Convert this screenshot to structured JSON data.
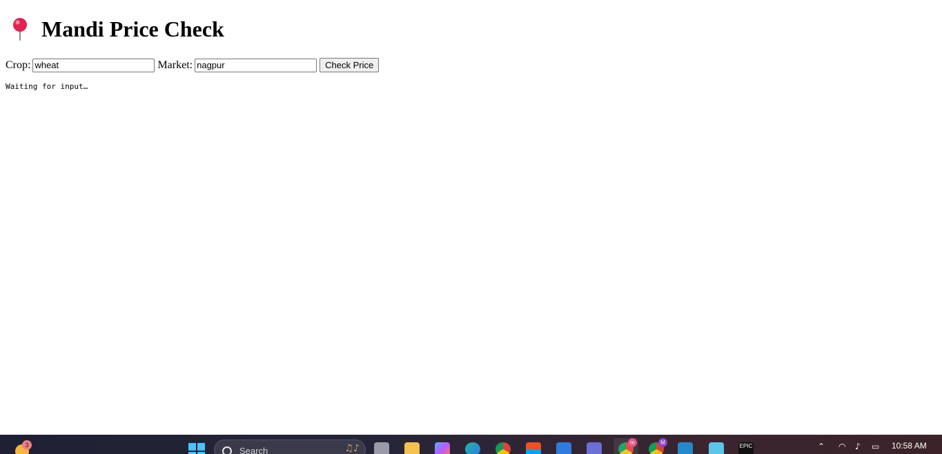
{
  "page": {
    "title_icon": "pushpin-icon",
    "title": "Mandi Price Check"
  },
  "form": {
    "crop_label": "Crop:",
    "crop_value": "wheat",
    "market_label": "Market:",
    "market_value": "nagpur",
    "submit_label": "Check Price"
  },
  "output": {
    "status_text": "Waiting for input…"
  },
  "taskbar": {
    "weather_badge": "3",
    "search_placeholder": "Search",
    "clock_time": "10:58 AM",
    "apps": [
      {
        "name": "start-menu-icon"
      },
      {
        "name": "task-view-icon"
      },
      {
        "name": "file-explorer-icon"
      },
      {
        "name": "copilot-icon"
      },
      {
        "name": "edge-icon"
      },
      {
        "name": "chrome-icon"
      },
      {
        "name": "microsoft-store-icon"
      },
      {
        "name": "outlook-icon"
      },
      {
        "name": "teams-icon"
      },
      {
        "name": "chrome-profile-m-icon",
        "badge": "m"
      },
      {
        "name": "chrome-profile-M-icon",
        "badge": "M"
      },
      {
        "name": "vscode-icon"
      },
      {
        "name": "notepad-icon"
      },
      {
        "name": "epic-games-icon"
      }
    ],
    "tray_icons": [
      "chevron-up-icon",
      "wifi-icon",
      "volume-icon",
      "battery-icon"
    ]
  },
  "colors": {
    "taskbar_bg": "#262538",
    "start_blue": "#4cc2ff",
    "chrome_badge_m": "#e0457b",
    "chrome_badge_M": "#8e44c9"
  }
}
